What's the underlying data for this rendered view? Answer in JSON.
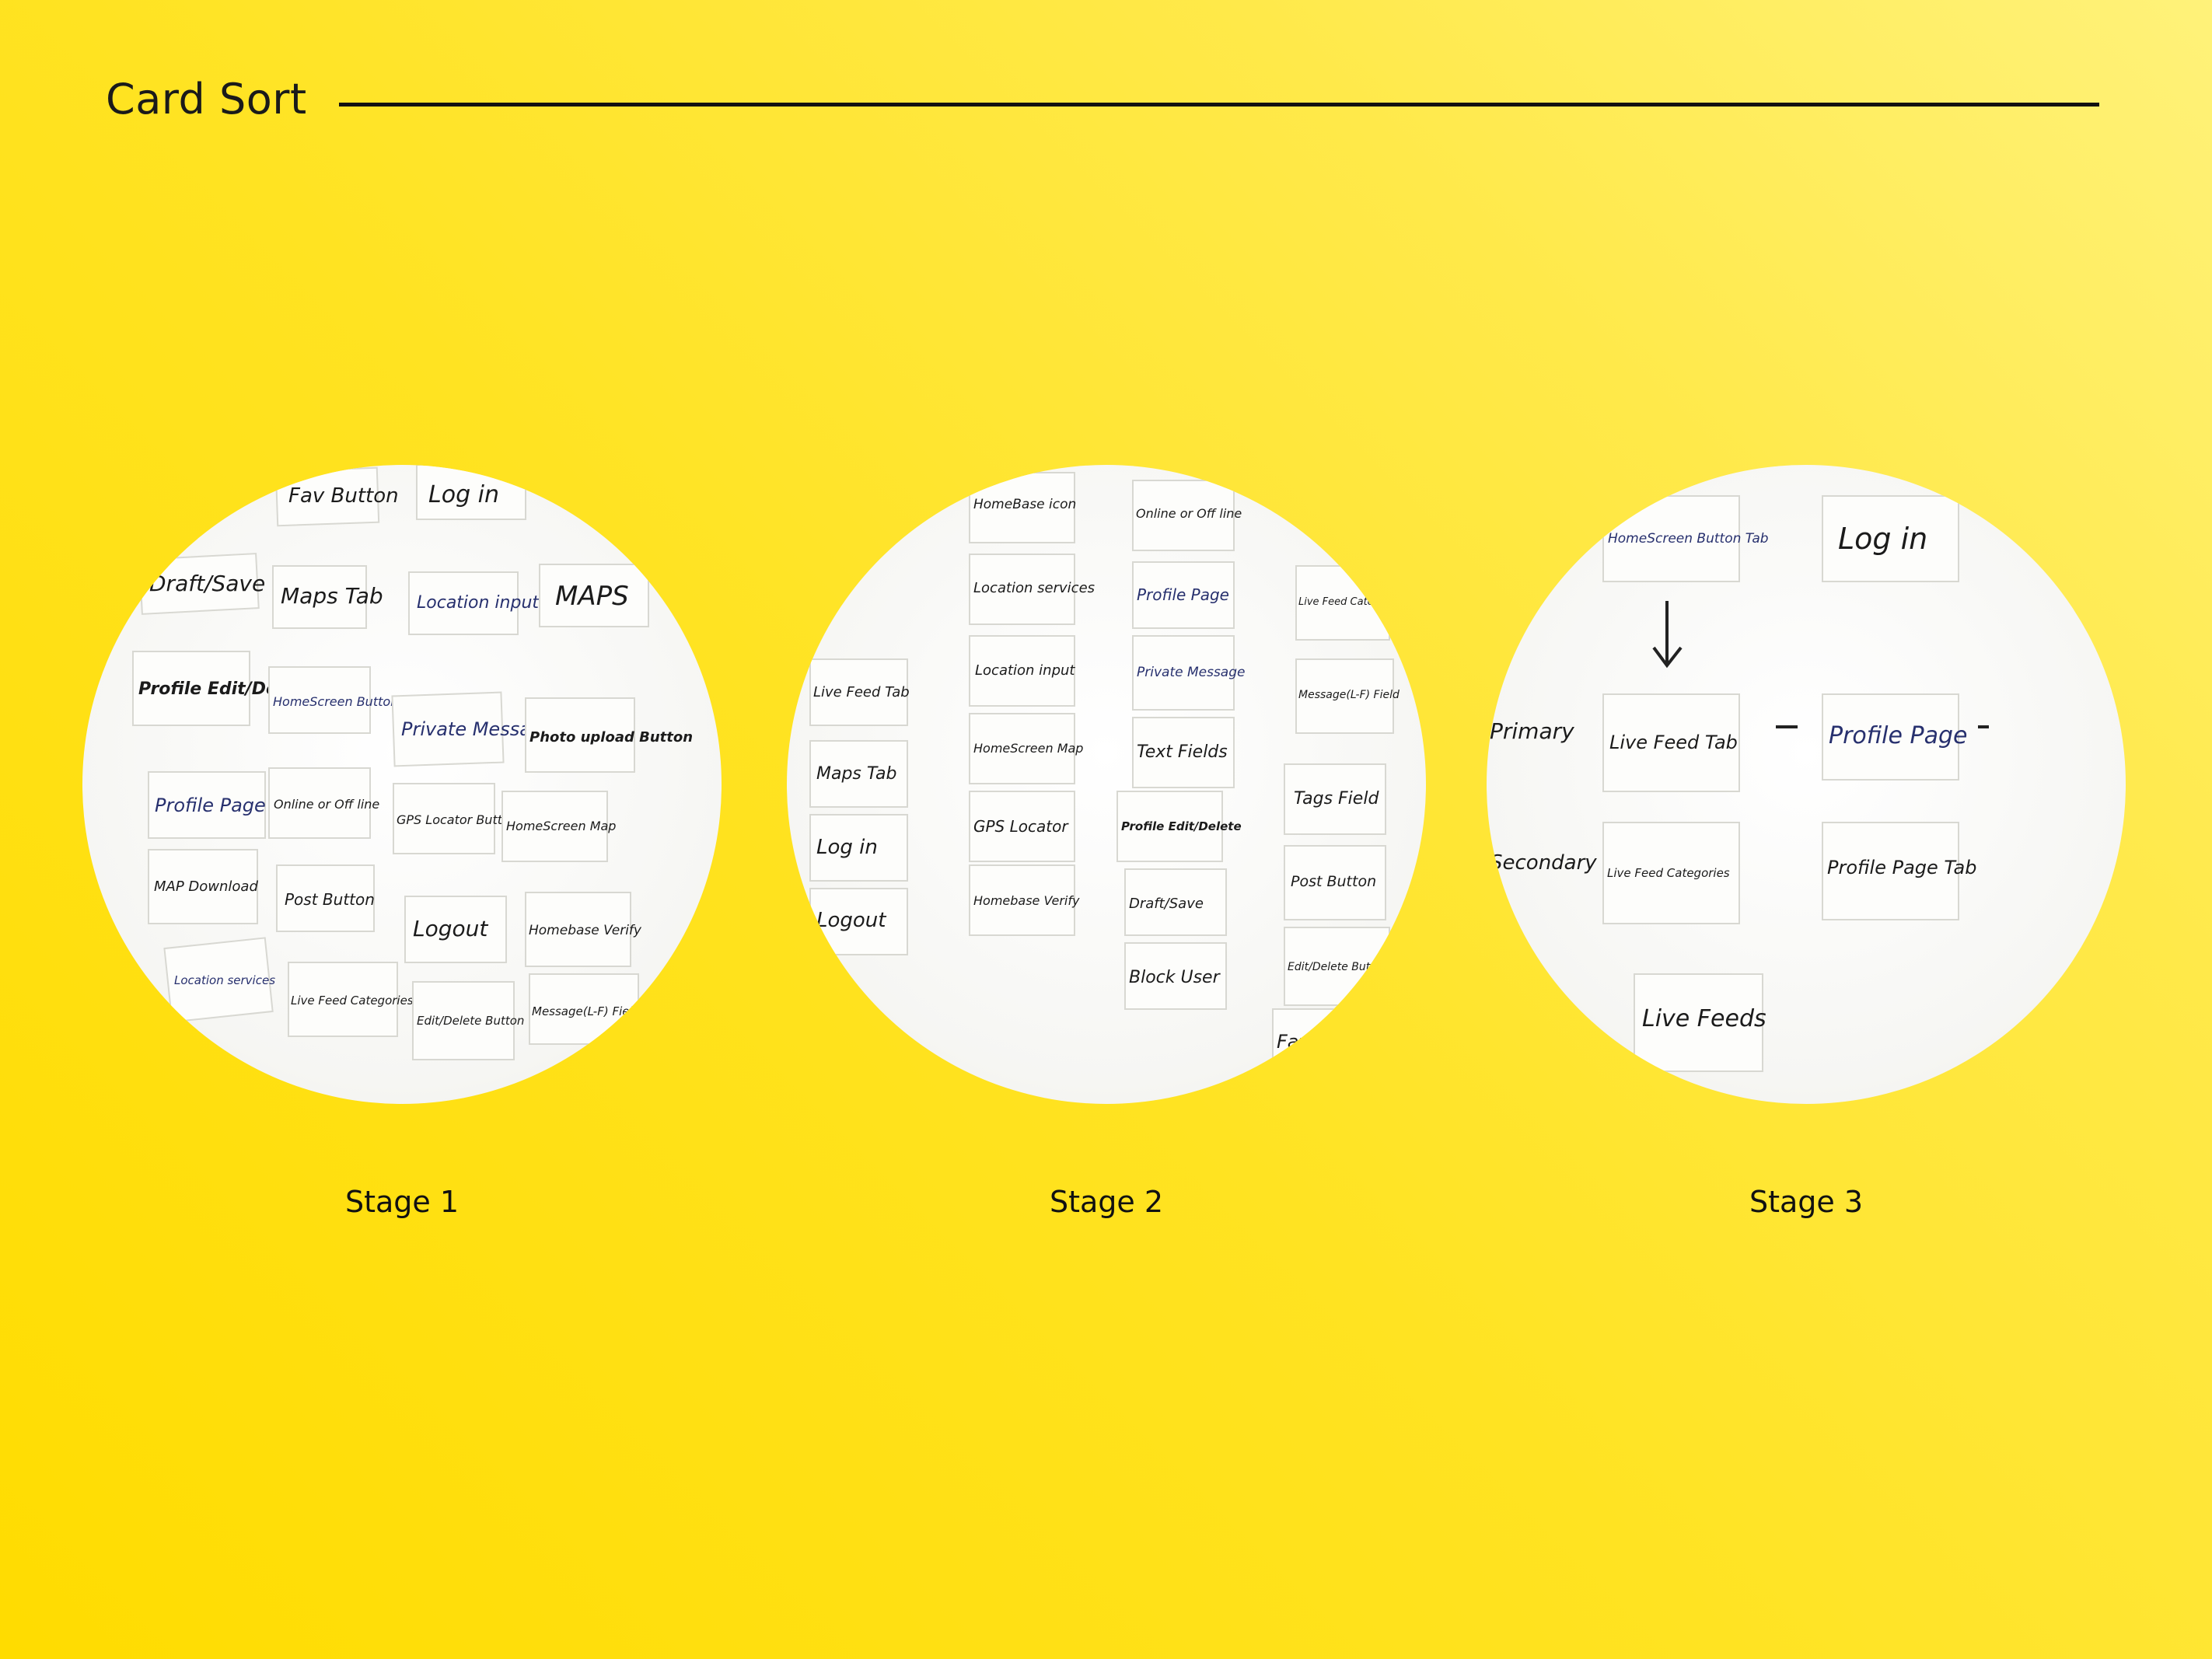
{
  "header": {
    "title": "Card Sort"
  },
  "stages": [
    {
      "label": "Stage 1",
      "cards": [
        "Fav Button",
        "Log in",
        "Draft/Save",
        "Maps Tab",
        "Location input",
        "MAPS",
        "Profile Edit/Delete",
        "HomeScreen Button Tab",
        "Private Message",
        "Photo upload Button",
        "Profile Page",
        "Online or Off line",
        "GPS Locator Button",
        "HomeScreen Map",
        "MAP Download",
        "Post Button",
        "Logout",
        "Homebase Verify",
        "Location services",
        "Live Feed Categories",
        "Edit/Delete Button",
        "Message(L-F) Field"
      ]
    },
    {
      "label": "Stage 2",
      "cards": [
        "HomeBase icon",
        "Online or Off line",
        "Profile Page",
        "Location services",
        "Live Feed Categories",
        "Location input",
        "Private Message",
        "Live Feed Tab",
        "HomeScreen Map",
        "Text Fields",
        "Message(L-F) Field",
        "Maps Tab",
        "GPS Locator",
        "Profile Edit/Delete",
        "Tags Field",
        "Log in",
        "Homebase Verify",
        "Draft/Save",
        "Post Button",
        "Logout",
        "Block User",
        "Edit/Delete Button",
        "Fav"
      ]
    },
    {
      "label": "Stage 3",
      "cards": [
        "HomeScreen Button Tab",
        "Log in",
        "Primary",
        "Live Feed Tab",
        "Profile Page",
        "Secondary",
        "Live Feed Categories",
        "Profile Page Tab",
        "Live Feeds"
      ]
    }
  ],
  "colors": {
    "accent": "#ffe322",
    "title_rule": "#111111"
  }
}
